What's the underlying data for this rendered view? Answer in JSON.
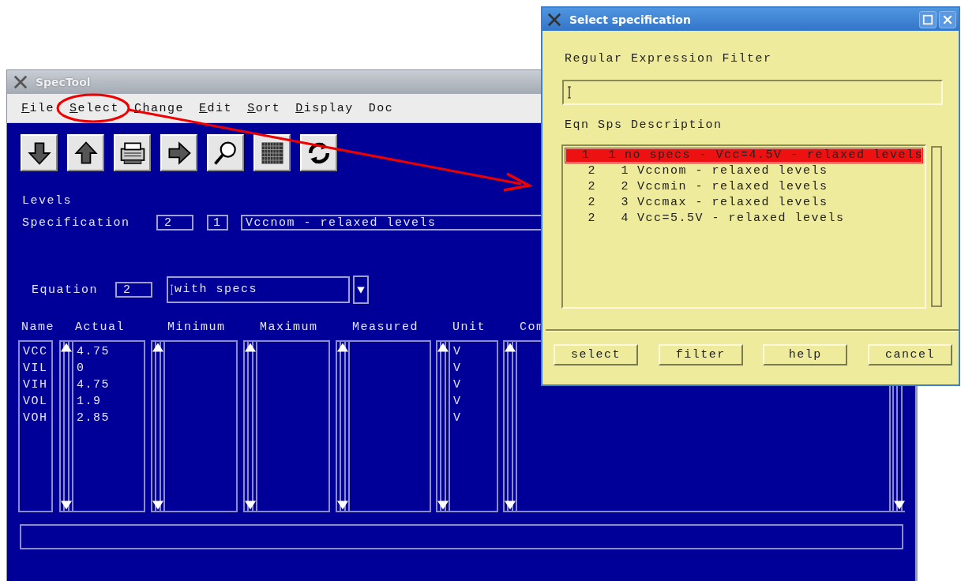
{
  "main_window": {
    "title": "SpecTool"
  },
  "menu": [
    {
      "label": "File",
      "underlined": true
    },
    {
      "label": "Select",
      "underlined": true
    },
    {
      "label": "Change",
      "underlined": true
    },
    {
      "label": "Edit",
      "underlined": true
    },
    {
      "label": "Sort",
      "underlined": true
    },
    {
      "label": "Display",
      "underlined": true
    },
    {
      "label": "Doc",
      "underlined": false
    }
  ],
  "levels_label": "Levels",
  "specification": {
    "label": "Specification",
    "equation": "2",
    "spec": "1",
    "description": "Vccnom - relaxed levels"
  },
  "equation": {
    "label": "Equation",
    "number": "2",
    "value": "with specs"
  },
  "table": {
    "columns": [
      "Name",
      "Actual",
      "Minimum",
      "Maximum",
      "Measured",
      "Unit",
      "Com"
    ],
    "rows": [
      {
        "name": "VCC",
        "actual": "4.75",
        "unit": "V"
      },
      {
        "name": "VIL",
        "actual": "0",
        "unit": "V"
      },
      {
        "name": "VIH",
        "actual": "4.75",
        "unit": "V"
      },
      {
        "name": "VOL",
        "actual": "1.9",
        "unit": "V"
      },
      {
        "name": "VOH",
        "actual": "2.85",
        "unit": "V"
      }
    ]
  },
  "dialog": {
    "title": "Select specification",
    "filter_label": "Regular Expression Filter",
    "list_header": "Eqn Sps Description",
    "rows": [
      {
        "eqn": "1",
        "sps": "1",
        "description": "no specs - Vcc=4.5V - relaxed levels",
        "selected": true
      },
      {
        "eqn": "2",
        "sps": "1",
        "description": "Vccnom - relaxed levels",
        "selected": false
      },
      {
        "eqn": "2",
        "sps": "2",
        "description": "Vccmin - relaxed levels",
        "selected": false
      },
      {
        "eqn": "2",
        "sps": "3",
        "description": "Vccmax - relaxed levels",
        "selected": false
      },
      {
        "eqn": "2",
        "sps": "4",
        "description": "Vcc=5.5V - relaxed levels",
        "selected": false
      }
    ],
    "buttons": [
      "select",
      "filter",
      "help",
      "cancel"
    ]
  }
}
